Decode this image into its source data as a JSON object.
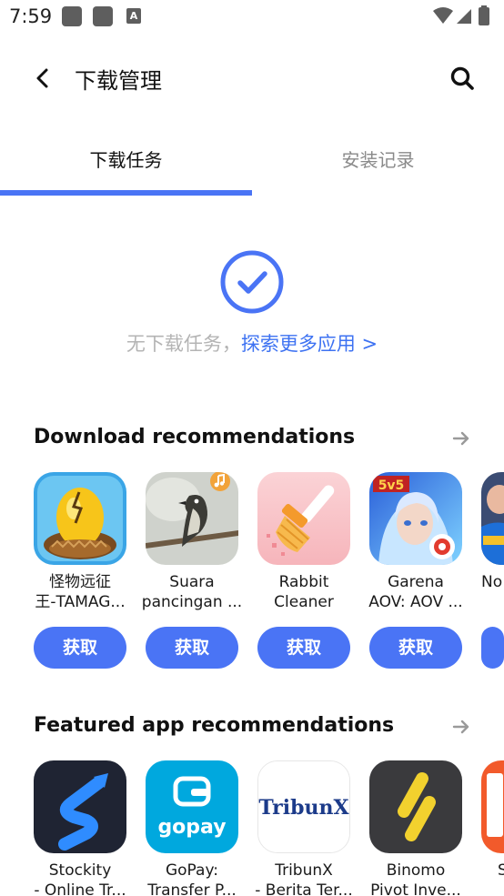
{
  "status_bar": {
    "time": "7:59",
    "a_badge": "A"
  },
  "app_bar": {
    "title": "下载管理"
  },
  "tabs": [
    {
      "label": "下载任务",
      "active": true
    },
    {
      "label": "安装记录",
      "active": false
    }
  ],
  "empty_state": {
    "text": "无下载任务，",
    "link": "探索更多应用 >"
  },
  "download_recs": {
    "title": "Download recommendations",
    "apps": [
      {
        "line1": "怪物远征",
        "line2": "王-TAMAG...",
        "button": "获取",
        "icon": "golden-egg-icon"
      },
      {
        "line1": "Suara",
        "line2": "pancingan ...",
        "button": "获取",
        "icon": "bird-photo-icon"
      },
      {
        "line1": "Rabbit",
        "line2": "Cleaner",
        "button": "获取",
        "icon": "broom-icon"
      },
      {
        "line1": "Garena",
        "line2": "AOV: AOV ...",
        "button": "获取",
        "icon": "aov-game-icon"
      },
      {
        "line1": "No",
        "line2": "",
        "button": "",
        "icon": "game-character-icon"
      }
    ]
  },
  "featured_recs": {
    "title": "Featured app recommendations",
    "apps": [
      {
        "line1": "Stockity",
        "line2": "- Online Tr...",
        "icon": "stockity-icon"
      },
      {
        "line1": "GoPay:",
        "line2": "Transfer P...",
        "icon": "gopay-icon",
        "logo_text": "gopay"
      },
      {
        "line1": "TribunX",
        "line2": "- Berita Ter...",
        "icon": "tribunx-icon",
        "logo_text": "TribunX"
      },
      {
        "line1": "Binomo",
        "line2": "Pivot Inve...",
        "icon": "binomo-icon"
      },
      {
        "line1": "S",
        "line2": "",
        "icon": "partial-app-icon"
      }
    ]
  },
  "colors": {
    "accent": "#4a74f5",
    "link": "#3d72f2",
    "muted": "#b4b4b4"
  }
}
